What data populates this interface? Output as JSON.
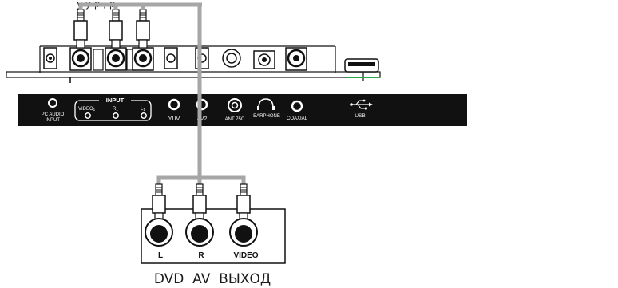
{
  "caption_top": "у                          у    р        ,              р",
  "panel": {
    "pc_audio_line1": "PC AUDIO",
    "pc_audio_line2": "INPUT",
    "input_title": "INPUT",
    "input_video": "VIDEO",
    "input_video_sub": "1",
    "input_r": "R",
    "input_r_sub": "1",
    "input_l": "L",
    "input_l_sub": "1",
    "yuv": "YUV",
    "av2": "AV2",
    "ant": "ANT 75Ω",
    "earphone": "EARPHONE",
    "coaxial": "COAXIAL",
    "usb": "USB"
  },
  "dvd_box": {
    "label_l": "L",
    "label_r": "R",
    "label_video": "VIDEO"
  },
  "bottom_caption": "DVD  AV  ВЫХОД",
  "colors": {
    "panel_bg": "#111111",
    "cable": "#a6a6a6",
    "usb_green": "#2aa84a",
    "line": "#111111"
  }
}
